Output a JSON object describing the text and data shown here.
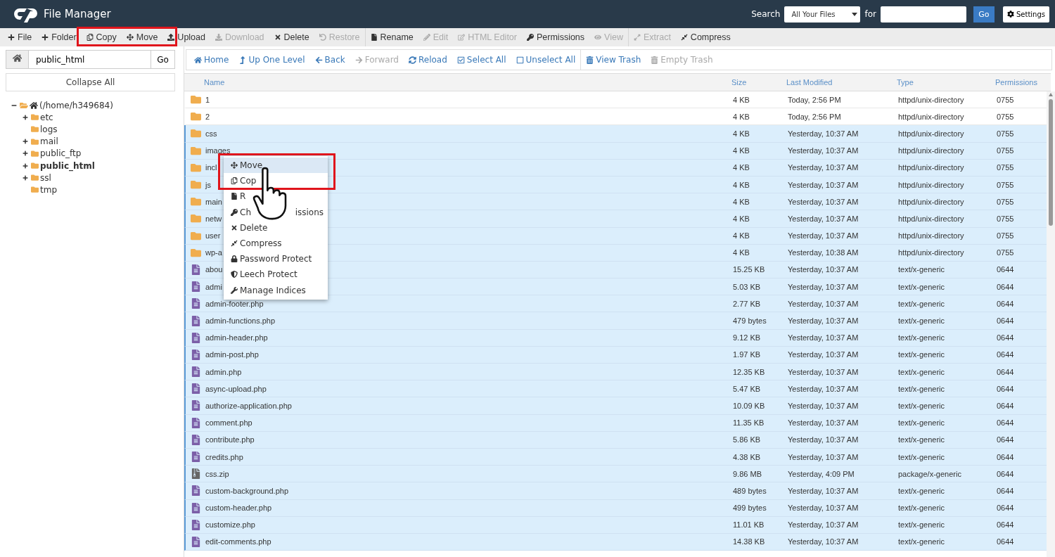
{
  "header": {
    "title": "File Manager",
    "search_label": "Search",
    "search_scope": "All Your Files",
    "for_label": "for",
    "go": "Go",
    "settings": "Settings"
  },
  "toolbar": [
    [
      {
        "label": "File",
        "disabled": false
      },
      {
        "label": "Folder",
        "disabled": false
      },
      {
        "label": "Copy",
        "disabled": false
      },
      {
        "label": "Move",
        "disabled": false
      },
      {
        "label": "Upload",
        "disabled": false
      },
      {
        "label": "Download",
        "disabled": true
      },
      {
        "label": "Delete",
        "disabled": false
      },
      {
        "label": "Restore",
        "disabled": true
      }
    ],
    [
      {
        "label": "Rename",
        "disabled": false
      },
      {
        "label": "Edit",
        "disabled": true
      },
      {
        "label": "HTML Editor",
        "disabled": true
      },
      {
        "label": "Permissions",
        "disabled": false
      },
      {
        "label": "View",
        "disabled": true
      }
    ],
    [
      {
        "label": "Extract",
        "disabled": true
      },
      {
        "label": "Compress",
        "disabled": false
      }
    ]
  ],
  "path": {
    "value": "public_html",
    "go": "Go"
  },
  "collapse_all": "Collapse All",
  "tree": [
    {
      "label": "(/home/h349684)",
      "expanded": true,
      "selected": false,
      "children": [
        {
          "label": "etc",
          "expanded": false,
          "selected": false
        },
        {
          "label": "logs",
          "selected": false
        },
        {
          "label": "mail",
          "expanded": false,
          "selected": false
        },
        {
          "label": "public_ftp",
          "expanded": false,
          "selected": false
        },
        {
          "label": "public_html",
          "expanded": false,
          "selected": true
        },
        {
          "label": "ssl",
          "expanded": false,
          "selected": false
        },
        {
          "label": "tmp",
          "selected": false
        }
      ]
    }
  ],
  "nav": [
    [
      {
        "label": "Home",
        "disabled": false
      },
      {
        "label": "Up One Level",
        "disabled": false
      },
      {
        "label": "Back",
        "disabled": false
      },
      {
        "label": "Forward",
        "disabled": true
      },
      {
        "label": "Reload",
        "disabled": false
      },
      {
        "label": "Select All",
        "disabled": false
      },
      {
        "label": "Unselect All",
        "disabled": false
      }
    ],
    [
      {
        "label": "View Trash",
        "disabled": false
      },
      {
        "label": "Empty Trash",
        "disabled": true
      }
    ]
  ],
  "table": {
    "columns": [
      "Name",
      "Size",
      "Last Modified",
      "Type",
      "Permissions"
    ],
    "rows": [
      {
        "kind": "folder",
        "name": "1",
        "size": "4 KB",
        "modified": "Today, 2:56 PM",
        "type": "httpd/unix-directory",
        "perms": "0755",
        "selected": false
      },
      {
        "kind": "folder",
        "name": "2",
        "size": "4 KB",
        "modified": "Today, 2:56 PM",
        "type": "httpd/unix-directory",
        "perms": "0755",
        "selected": false
      },
      {
        "kind": "folder",
        "name": "css",
        "size": "4 KB",
        "modified": "Yesterday, 10:37 AM",
        "type": "httpd/unix-directory",
        "perms": "0755",
        "selected": true
      },
      {
        "kind": "folder",
        "name": "images",
        "size": "4 KB",
        "modified": "Yesterday, 10:37 AM",
        "type": "httpd/unix-directory",
        "perms": "0755",
        "selected": true
      },
      {
        "kind": "folder",
        "name": "incl",
        "size": "4 KB",
        "modified": "Yesterday, 10:37 AM",
        "type": "httpd/unix-directory",
        "perms": "0755",
        "selected": true
      },
      {
        "kind": "folder",
        "name": "js",
        "size": "4 KB",
        "modified": "Yesterday, 10:37 AM",
        "type": "httpd/unix-directory",
        "perms": "0755",
        "selected": true
      },
      {
        "kind": "folder",
        "name": "main",
        "size": "4 KB",
        "modified": "Yesterday, 10:37 AM",
        "type": "httpd/unix-directory",
        "perms": "0755",
        "selected": true
      },
      {
        "kind": "folder",
        "name": "netw",
        "size": "4 KB",
        "modified": "Yesterday, 10:37 AM",
        "type": "httpd/unix-directory",
        "perms": "0755",
        "selected": true
      },
      {
        "kind": "folder",
        "name": "user",
        "size": "4 KB",
        "modified": "Yesterday, 10:37 AM",
        "type": "httpd/unix-directory",
        "perms": "0755",
        "selected": true
      },
      {
        "kind": "folder",
        "name": "wp-a",
        "size": "4 KB",
        "modified": "Yesterday, 10:38 AM",
        "type": "httpd/unix-directory",
        "perms": "0755",
        "selected": true
      },
      {
        "kind": "file",
        "name": "abou",
        "size": "15.25 KB",
        "modified": "Yesterday, 10:37 AM",
        "type": "text/x-generic",
        "perms": "0644",
        "selected": true
      },
      {
        "kind": "file",
        "name": "admi",
        "size": "5.03 KB",
        "modified": "Yesterday, 10:37 AM",
        "type": "text/x-generic",
        "perms": "0644",
        "selected": true
      },
      {
        "kind": "file",
        "name": "admin-footer.php",
        "size": "2.77 KB",
        "modified": "Yesterday, 10:37 AM",
        "type": "text/x-generic",
        "perms": "0644",
        "selected": true
      },
      {
        "kind": "file",
        "name": "admin-functions.php",
        "size": "479 bytes",
        "modified": "Yesterday, 10:37 AM",
        "type": "text/x-generic",
        "perms": "0644",
        "selected": true
      },
      {
        "kind": "file",
        "name": "admin-header.php",
        "size": "9.12 KB",
        "modified": "Yesterday, 10:37 AM",
        "type": "text/x-generic",
        "perms": "0644",
        "selected": true
      },
      {
        "kind": "file",
        "name": "admin-post.php",
        "size": "1.97 KB",
        "modified": "Yesterday, 10:37 AM",
        "type": "text/x-generic",
        "perms": "0644",
        "selected": true
      },
      {
        "kind": "file",
        "name": "admin.php",
        "size": "12.35 KB",
        "modified": "Yesterday, 10:37 AM",
        "type": "text/x-generic",
        "perms": "0644",
        "selected": true
      },
      {
        "kind": "file",
        "name": "async-upload.php",
        "size": "5.47 KB",
        "modified": "Yesterday, 10:37 AM",
        "type": "text/x-generic",
        "perms": "0644",
        "selected": true
      },
      {
        "kind": "file",
        "name": "authorize-application.php",
        "size": "10.09 KB",
        "modified": "Yesterday, 10:37 AM",
        "type": "text/x-generic",
        "perms": "0644",
        "selected": true
      },
      {
        "kind": "file",
        "name": "comment.php",
        "size": "11.35 KB",
        "modified": "Yesterday, 10:37 AM",
        "type": "text/x-generic",
        "perms": "0644",
        "selected": true
      },
      {
        "kind": "file",
        "name": "contribute.php",
        "size": "5.86 KB",
        "modified": "Yesterday, 10:37 AM",
        "type": "text/x-generic",
        "perms": "0644",
        "selected": true
      },
      {
        "kind": "file",
        "name": "credits.php",
        "size": "4.38 KB",
        "modified": "Yesterday, 10:37 AM",
        "type": "text/x-generic",
        "perms": "0644",
        "selected": true
      },
      {
        "kind": "archive",
        "name": "css.zip",
        "size": "9.86 MB",
        "modified": "Yesterday, 4:09 PM",
        "type": "package/x-generic",
        "perms": "0644",
        "selected": true
      },
      {
        "kind": "file",
        "name": "custom-background.php",
        "size": "489 bytes",
        "modified": "Yesterday, 10:37 AM",
        "type": "text/x-generic",
        "perms": "0644",
        "selected": true
      },
      {
        "kind": "file",
        "name": "custom-header.php",
        "size": "499 bytes",
        "modified": "Yesterday, 10:37 AM",
        "type": "text/x-generic",
        "perms": "0644",
        "selected": true
      },
      {
        "kind": "file",
        "name": "customize.php",
        "size": "11.01 KB",
        "modified": "Yesterday, 10:37 AM",
        "type": "text/x-generic",
        "perms": "0644",
        "selected": true
      },
      {
        "kind": "file",
        "name": "edit-comments.php",
        "size": "14.38 KB",
        "modified": "Yesterday, 10:37 AM",
        "type": "text/x-generic",
        "perms": "0644",
        "selected": true
      }
    ]
  },
  "context_menu": [
    {
      "label": "Move",
      "selected": true
    },
    {
      "label": "Cop",
      "selected": false
    },
    {
      "label": "R",
      "selected": false
    },
    {
      "label": "Ch",
      "label_end": "issions",
      "selected": false
    },
    {
      "label": "Delete",
      "selected": false
    },
    {
      "label": "Compress",
      "selected": false
    },
    {
      "label": "Password Protect",
      "selected": false
    },
    {
      "label": "Leech Protect",
      "selected": false
    },
    {
      "label": "Manage Indices",
      "selected": false
    }
  ]
}
